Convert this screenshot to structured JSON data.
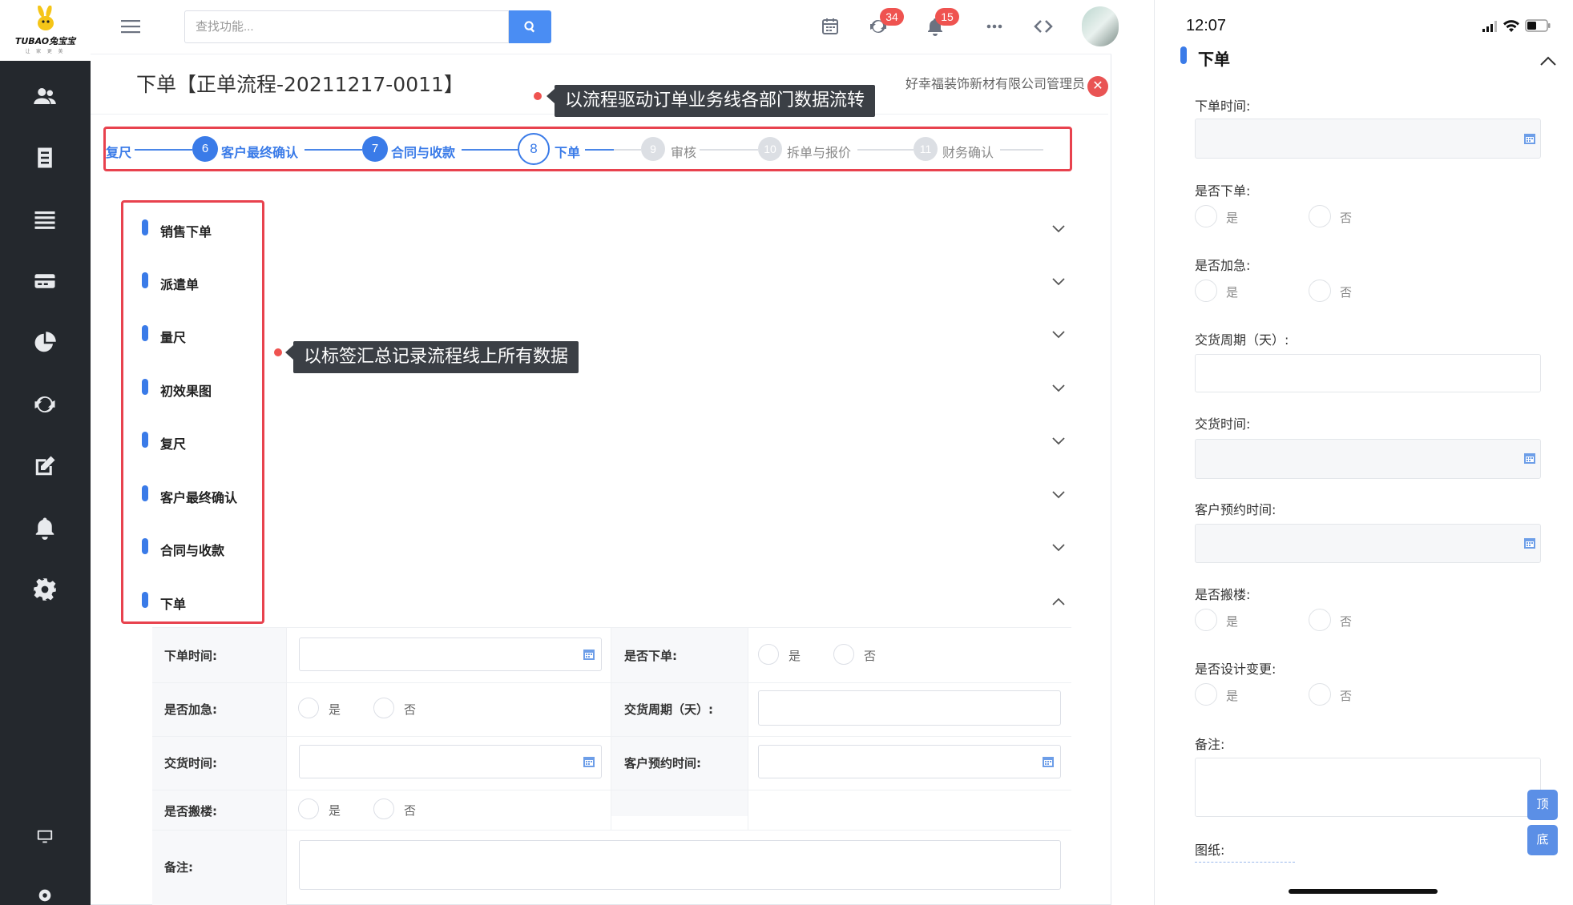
{
  "desktop": {
    "logo": {
      "text": "TUBAO兔宝宝",
      "subtext": "让 家 更 美"
    },
    "search": {
      "placeholder": "查找功能..."
    },
    "badges": {
      "sync": "34",
      "notify": "15"
    },
    "page_title": "下单【正单流程-20211217-0011】",
    "company": "好幸福装饰新材有限公司管理员",
    "tooltips": {
      "flow": "以流程驱动订单业务线各部门数据流转",
      "tabs": "以标签汇总记录流程线上所有数据"
    },
    "steps": [
      {
        "num": "",
        "label": "复尺",
        "state": "done"
      },
      {
        "num": "6",
        "label": "客户最终确认",
        "state": "done"
      },
      {
        "num": "7",
        "label": "合同与收款",
        "state": "done"
      },
      {
        "num": "8",
        "label": "下单",
        "state": "current"
      },
      {
        "num": "9",
        "label": "审核",
        "state": "pending"
      },
      {
        "num": "10",
        "label": "拆单与报价",
        "state": "pending"
      },
      {
        "num": "11",
        "label": "财务确认",
        "state": "pending"
      }
    ],
    "sections": [
      "销售下单",
      "派遣单",
      "量尺",
      "初效果图",
      "复尺",
      "客户最终确认",
      "合同与收款",
      "下单"
    ],
    "form": {
      "order_time": "下单时间:",
      "is_order": "是否下单:",
      "is_urgent": "是否加急:",
      "delivery_cycle": "交货周期（天）:",
      "delivery_time": "交货时间:",
      "appointment_time": "客户预约时间:",
      "is_moving": "是否搬楼:",
      "remark": "备注:",
      "yes": "是",
      "no": "否"
    },
    "colors": {
      "accent": "#3a7be8",
      "highlight_box": "#e8424e",
      "sidebar": "#24282d",
      "badge": "#ef5350"
    }
  },
  "mobile": {
    "time": "12:07",
    "title": "下单",
    "labels": {
      "order_time": "下单时间:",
      "is_order": "是否下单:",
      "is_urgent": "是否加急:",
      "delivery_cycle": "交货周期（天）:",
      "delivery_time": "交货时间:",
      "appointment_time": "客户预约时间:",
      "is_moving": "是否搬楼:",
      "design_change": "是否设计变更:",
      "remark": "备注:",
      "drawing": "图纸:"
    },
    "yes": "是",
    "no": "否",
    "float_top": "顶",
    "float_bottom": "底"
  }
}
